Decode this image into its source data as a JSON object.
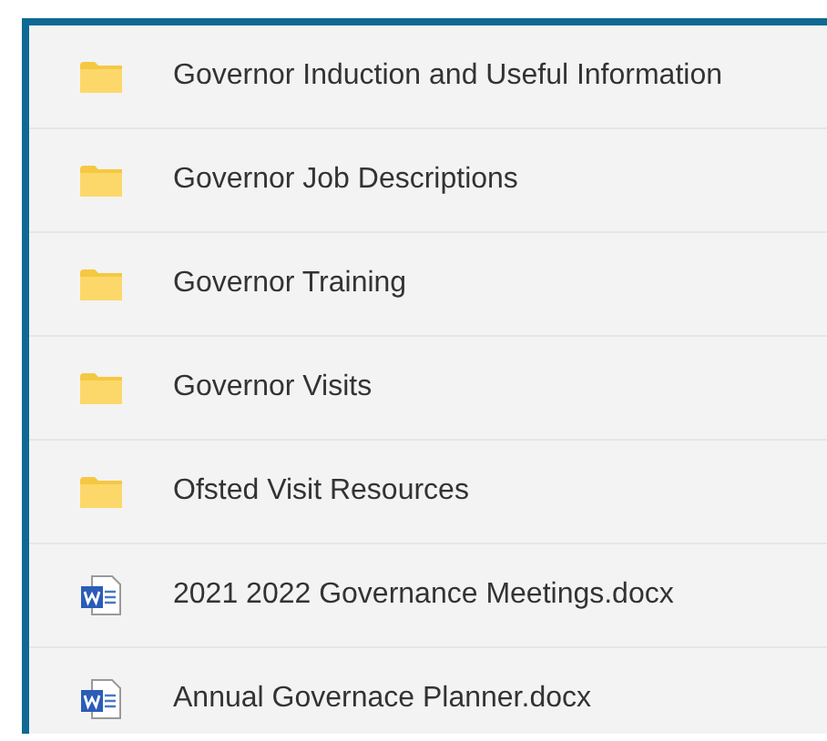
{
  "files": [
    {
      "kind": "folder",
      "name": "Governor Induction and Useful Information"
    },
    {
      "kind": "folder",
      "name": "Governor Job Descriptions"
    },
    {
      "kind": "folder",
      "name": "Governor Training"
    },
    {
      "kind": "folder",
      "name": "Governor Visits"
    },
    {
      "kind": "folder",
      "name": "Ofsted Visit Resources"
    },
    {
      "kind": "document",
      "name": "2021 2022 Governance Meetings.docx"
    },
    {
      "kind": "document",
      "name": "Annual Governace Planner.docx"
    }
  ]
}
